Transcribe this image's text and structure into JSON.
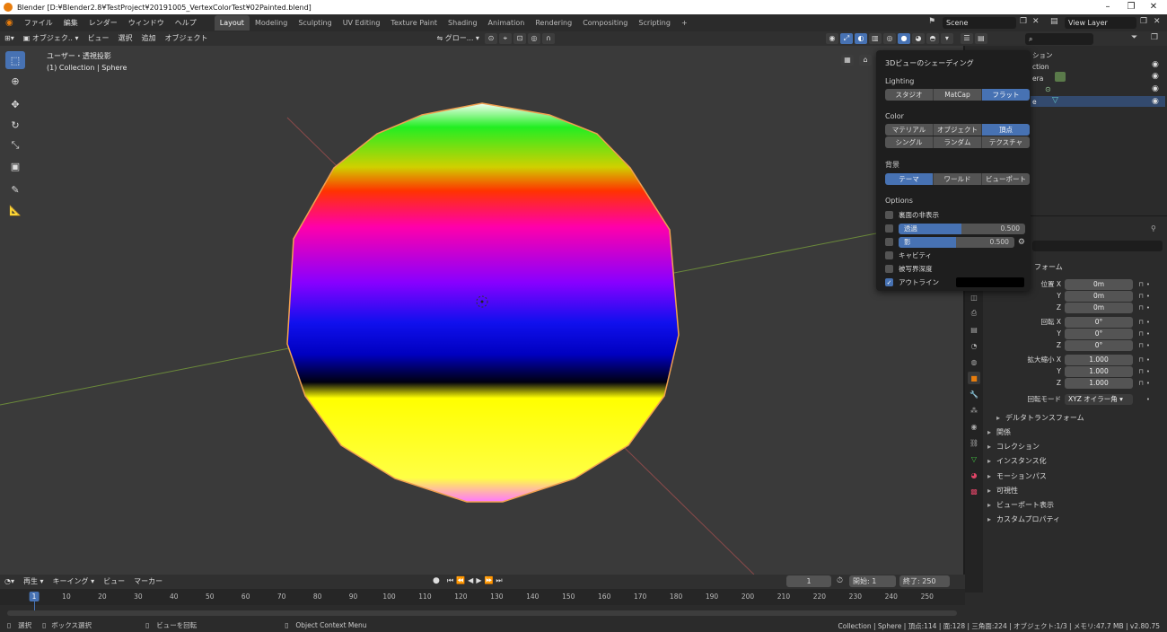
{
  "window": {
    "title": "Blender [D:¥Blender2.8¥TestProject¥20191005_VertexColorTest¥02Painted.blend]",
    "controls": [
      "–",
      "❐",
      "✕"
    ]
  },
  "menus": [
    "ファイル",
    "編集",
    "レンダー",
    "ウィンドウ",
    "ヘルプ"
  ],
  "workspaces": [
    "Layout",
    "Modeling",
    "Sculpting",
    "UV Editing",
    "Texture Paint",
    "Shading",
    "Animation",
    "Rendering",
    "Compositing",
    "Scripting"
  ],
  "scene": "Scene",
  "view_layer": "View Layer",
  "viewport_header": {
    "mode": "オブジェク..",
    "menus": [
      "ビュー",
      "選択",
      "追加",
      "オブジェクト"
    ],
    "transform": "グロー..."
  },
  "viewport": {
    "view_name": "ユーザー・透視投影",
    "collection_info": "(1) Collection | Sphere"
  },
  "shading_popover": {
    "title": "3Dビューのシェーディング",
    "lighting_label": "Lighting",
    "lighting": [
      "スタジオ",
      "MatCap",
      "フラット"
    ],
    "lighting_selected": "フラット",
    "color_label": "Color",
    "color_row1": [
      "マテリアル",
      "オブジェクト",
      "頂点"
    ],
    "color_row2": [
      "シングル",
      "ランダム",
      "テクスチャ"
    ],
    "color_selected": "頂点",
    "background_label": "背景",
    "background": [
      "テーマ",
      "ワールド",
      "ビューポート"
    ],
    "background_selected": "テーマ",
    "options_label": "Options",
    "opt_backface": "裏面の非表示",
    "opt_xray": "透過",
    "opt_xray_value": "0.500",
    "opt_xray_fraction": 0.5,
    "opt_shadow": "影",
    "opt_shadow_value": "0.500",
    "opt_shadow_fraction": 0.5,
    "opt_cavity": "キャビティ",
    "opt_dof": "被写界深度",
    "opt_outline": "アウトライン"
  },
  "outliner": {
    "partial_items": [
      "ション",
      "ction",
      "era",
      "e"
    ]
  },
  "properties": {
    "section_transform": "フォーム",
    "location_label": "位置 X",
    "rotation_label": "回転 X",
    "scale_label": "拡大縮小 X",
    "y": "Y",
    "z": "Z",
    "location": [
      "0m",
      "0m",
      "0m"
    ],
    "rotation": [
      "0°",
      "0°",
      "0°"
    ],
    "scale": [
      "1.000",
      "1.000",
      "1.000"
    ],
    "rotation_mode_label": "回転モード",
    "rotation_mode": "XYZ オイラー角",
    "delta": "デルタトランスフォーム",
    "sections": [
      "関係",
      "コレクション",
      "インスタンス化",
      "モーションパス",
      "可視性",
      "ビューポート表示",
      "カスタムプロパティ"
    ]
  },
  "timeline": {
    "menus": [
      "再生",
      "キーイング",
      "ビュー",
      "マーカー"
    ],
    "current_frame": "1",
    "start_label": "開始:",
    "start": "1",
    "end_label": "終了:",
    "end": "250",
    "ticks": [
      "1",
      "10",
      "20",
      "30",
      "40",
      "50",
      "60",
      "70",
      "80",
      "90",
      "100",
      "110",
      "120",
      "130",
      "140",
      "150",
      "160",
      "170",
      "180",
      "190",
      "200",
      "210",
      "220",
      "230",
      "240",
      "250"
    ]
  },
  "statusbar": {
    "select": "選択",
    "box_select": "ボックス選択",
    "rotate_view": "ビューを回転",
    "context_menu": "Object Context Menu",
    "stats": "Collection | Sphere | 頂点:114 | 面:128 | 三角面:224 | オブジェクト:1/3 | メモリ:47.7 MB | v2.80.75"
  },
  "colors": {
    "accent": "#4772b3",
    "viewport_bg": "#3a3a3a",
    "panel_bg": "#2b2b2b"
  }
}
